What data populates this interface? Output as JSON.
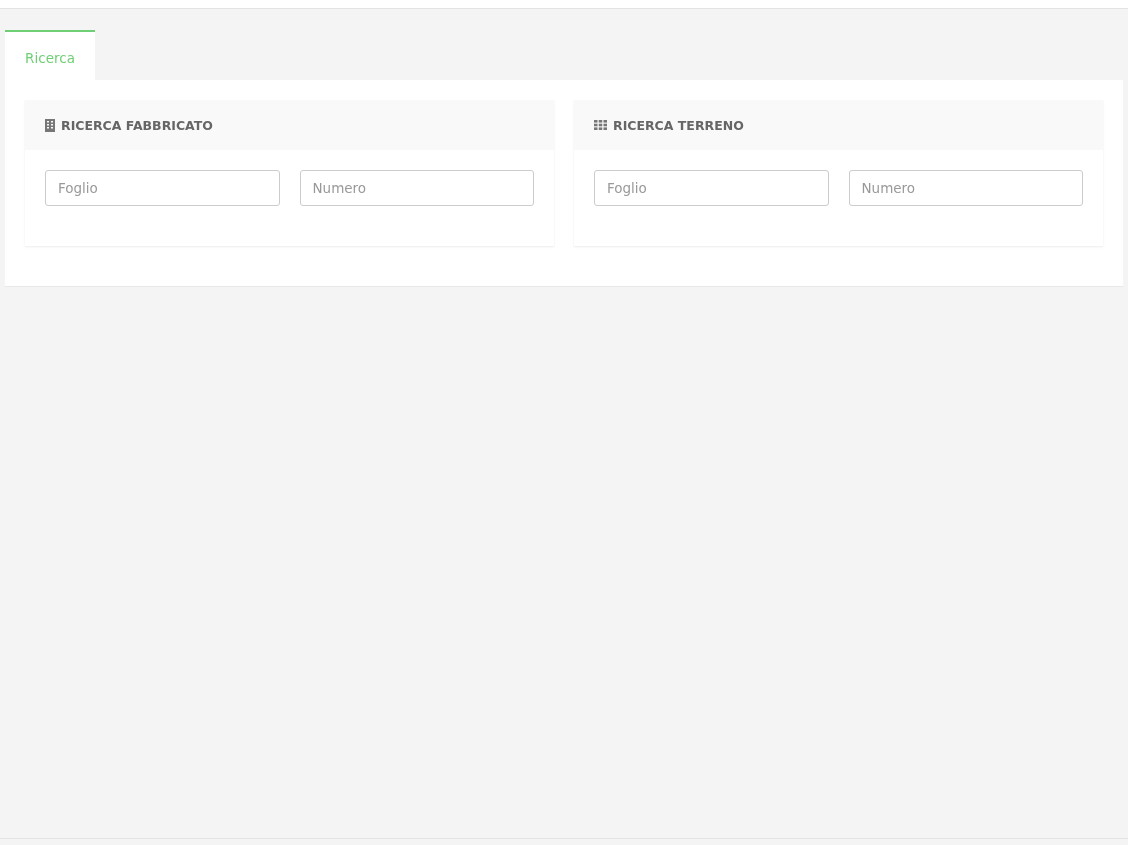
{
  "tabs": [
    {
      "label": "Ricerca",
      "selected": true
    }
  ],
  "panels": [
    {
      "title": "RICERCA FABBRICATO",
      "kind": "building",
      "fields": [
        {
          "placeholder": "Foglio"
        },
        {
          "placeholder": "Numero"
        }
      ]
    },
    {
      "title": "RICERCA TERRENO",
      "kind": "grid",
      "fields": [
        {
          "placeholder": "Foglio"
        },
        {
          "placeholder": "Numero"
        }
      ]
    }
  ]
}
